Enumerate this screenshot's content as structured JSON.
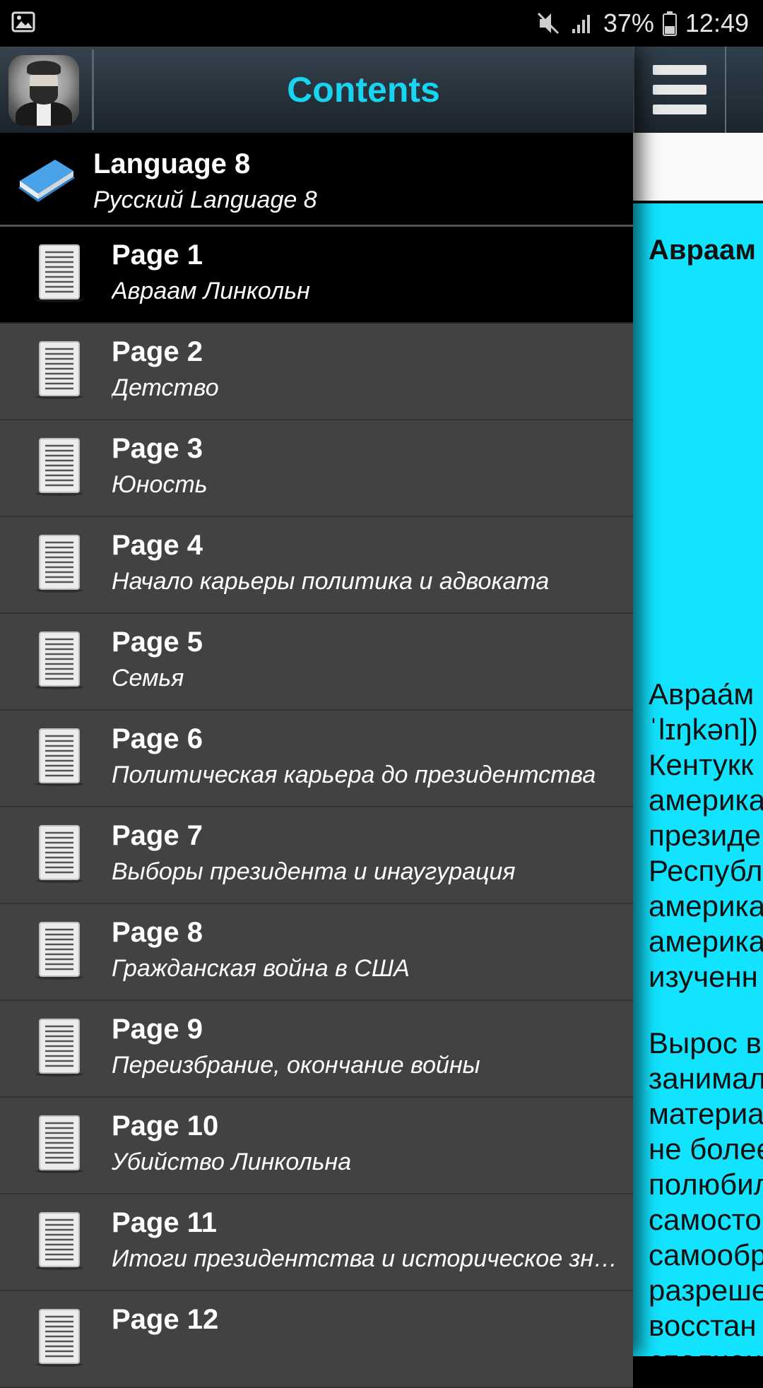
{
  "status_bar": {
    "battery": "37%",
    "time": "12:49",
    "icons": [
      "image-icon",
      "mute-icon",
      "signal-icon",
      "battery-icon"
    ]
  },
  "drawer": {
    "title": "Contents",
    "book": {
      "title": "Language 8",
      "subtitle": "Русский Language 8"
    },
    "items": [
      {
        "title": "Page 1",
        "subtitle": "Авраам Линкольн",
        "active": true
      },
      {
        "title": "Page 2",
        "subtitle": "Детство"
      },
      {
        "title": "Page 3",
        "subtitle": "Юность"
      },
      {
        "title": "Page 4",
        "subtitle": "Начало карьеры политика и адвоката"
      },
      {
        "title": "Page 5",
        "subtitle": "Семья"
      },
      {
        "title": "Page 6",
        "subtitle": "Политическая карьера до президентства"
      },
      {
        "title": "Page 7",
        "subtitle": "Выборы президента и инаугурация"
      },
      {
        "title": "Page 8",
        "subtitle": "Гражданская война в США"
      },
      {
        "title": "Page 9",
        "subtitle": "Переизбрание, окончание войны"
      },
      {
        "title": "Page 10",
        "subtitle": "Убийство Линкольна"
      },
      {
        "title": "Page 11",
        "subtitle": "Итоги президентства и историческое зна..."
      },
      {
        "title": "Page 12",
        "subtitle": ""
      }
    ]
  },
  "content": {
    "heading": "Авраам",
    "paragraph1": [
      "Авраа́м",
      "ˈlɪŋkən]) (",
      "Кентукк",
      "америка",
      "президе",
      "Республ",
      "америка",
      "америка",
      "изученн"
    ],
    "paragraph2": [
      "Вырос в",
      "занимал",
      "материа",
      "не более",
      "полюбил",
      "самосто",
      "самообр",
      "разреше",
      "восстан",
      "сполнен"
    ]
  },
  "colors": {
    "title_accent": "#19d4f0",
    "content_bg": "#12e3ff",
    "drawer_bg": "#424242",
    "active_bg": "#000000"
  }
}
